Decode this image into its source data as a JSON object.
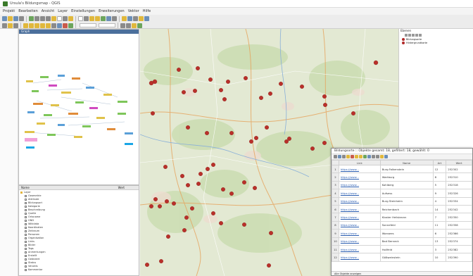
{
  "window": {
    "title": "Ursula's Bildungsmap - QGIS"
  },
  "menubar": [
    "Projekt",
    "Bearbeiten",
    "Ansicht",
    "Layer",
    "Einstellungen",
    "Erweiterungen",
    "Vektor",
    "Hilfe"
  ],
  "graph_panel": {
    "title": "Graph"
  },
  "layers_panel": {
    "header_name": "Name",
    "header_value": "Wert",
    "root": "Layer",
    "items": [
      "Geometrie",
      "Attribute",
      "Bildungsort",
      "Kategorie",
      "Beschreibung",
      "Quelle",
      "Ortsname",
      "GND",
      "Wikidata",
      "Koordinaten",
      "Zeitraum",
      "Personen",
      "Organisation",
      "Links",
      "Bilder",
      "Tags",
      "Anmerkungen",
      "Erstellt",
      "Geändert",
      "Status",
      "Verweis",
      "Kommentar"
    ]
  },
  "layers_tree": {
    "title": "Ebenen",
    "layers": [
      {
        "name": "Bildungsorte",
        "color": "#b22a2a"
      },
      {
        "name": "Hintergrundkarte",
        "color": "#b22a2a"
      }
    ]
  },
  "attribute_table": {
    "title": "Bildungsorte :: Objekte gesamt: 18, gefiltert: 18, gewählt: 0",
    "columns": [
      "",
      "Link",
      "Name",
      "Art",
      "Wert"
    ],
    "rows": [
      [
        "1",
        "https://www...",
        "Burg Falkenstein",
        "12",
        "252302"
      ],
      [
        "2",
        "https://www...",
        "Wartburg",
        "8",
        "252310"
      ],
      [
        "3",
        "https://www...",
        "Kohlberg",
        "5",
        "252318"
      ],
      [
        "4",
        "https://www...",
        "Aufsess",
        "9",
        "252326"
      ],
      [
        "5",
        "https://www...",
        "Burg Steinheim",
        "4",
        "252334"
      ],
      [
        "6",
        "https://www...",
        "Reichenbach",
        "14",
        "252342"
      ],
      [
        "7",
        "https://www...",
        "Kloster Heilsbronn",
        "7",
        "252350"
      ],
      [
        "8",
        "https://www...",
        "Sonnefeld",
        "11",
        "252358"
      ],
      [
        "9",
        "https://www...",
        "Wonsees",
        "6",
        "252366"
      ],
      [
        "10",
        "https://www...",
        "Bad Berneck",
        "13",
        "252374"
      ],
      [
        "11",
        "https://www...",
        "Hollfeld",
        "3",
        "252382"
      ],
      [
        "12",
        "https://www...",
        "Gößweinstein",
        "10",
        "252390"
      ]
    ],
    "footer": "Alle Objekte anzeigen"
  }
}
